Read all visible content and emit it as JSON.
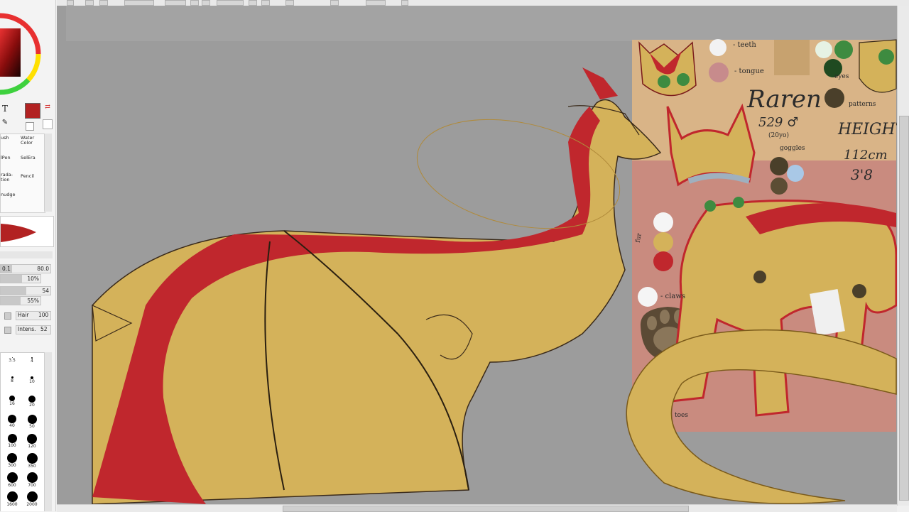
{
  "tools": {
    "text_tool": "T"
  },
  "brushes": [
    {
      "label": "ush"
    },
    {
      "label": "Water Color"
    },
    {
      "label": "lPen"
    },
    {
      "label": "SelEra"
    },
    {
      "label": "rada-\ntion"
    },
    {
      "label": "Pencil"
    },
    {
      "label": "nudge"
    },
    {
      "label": ""
    }
  ],
  "brush_settings": {
    "size_prefix": "0.1",
    "size_value": "80.0",
    "density": "10%",
    "blend": "54",
    "opacity": "55%",
    "texture_label": "Hair",
    "texture_value": "100",
    "intensity_label": "Intens.",
    "intensity_value": "52"
  },
  "brush_sizes": [
    {
      "label": "3.5",
      "d": 1
    },
    {
      "label": "4",
      "d": 2
    },
    {
      "label": "8",
      "d": 3
    },
    {
      "label": "10",
      "d": 4
    },
    {
      "label": "16",
      "d": 8
    },
    {
      "label": "20",
      "d": 10
    },
    {
      "label": "40",
      "d": 12
    },
    {
      "label": "50",
      "d": 13
    },
    {
      "label": "100",
      "d": 13
    },
    {
      "label": "120",
      "d": 14
    },
    {
      "label": "300",
      "d": 14
    },
    {
      "label": "350",
      "d": 15
    },
    {
      "label": "600",
      "d": 15
    },
    {
      "label": "700",
      "d": 15
    },
    {
      "label": "1600",
      "d": 15
    },
    {
      "label": "2000",
      "d": 15
    }
  ],
  "reference_sheet": {
    "teeth_label": "- teeth",
    "tongue_label": "- tongue",
    "eyes_label": "eyes",
    "patterns_label": "patterns",
    "name": "Raren",
    "age_line": "529 ♂",
    "age_sub": "(20yo)",
    "goggles_label": "goggles",
    "height_label": "HEIGHT",
    "height_cm": "112cm",
    "height_ft": "3'8",
    "fur_label": "fur",
    "claws_label": "- claws",
    "toes_label": "toes"
  },
  "colors": {
    "primary": "#b22222",
    "fur_yellow": "#d4b25a",
    "mane_red": "#c0272d",
    "canvas_bg": "#9c9c9c",
    "ref_bg": "#c98b7f"
  }
}
